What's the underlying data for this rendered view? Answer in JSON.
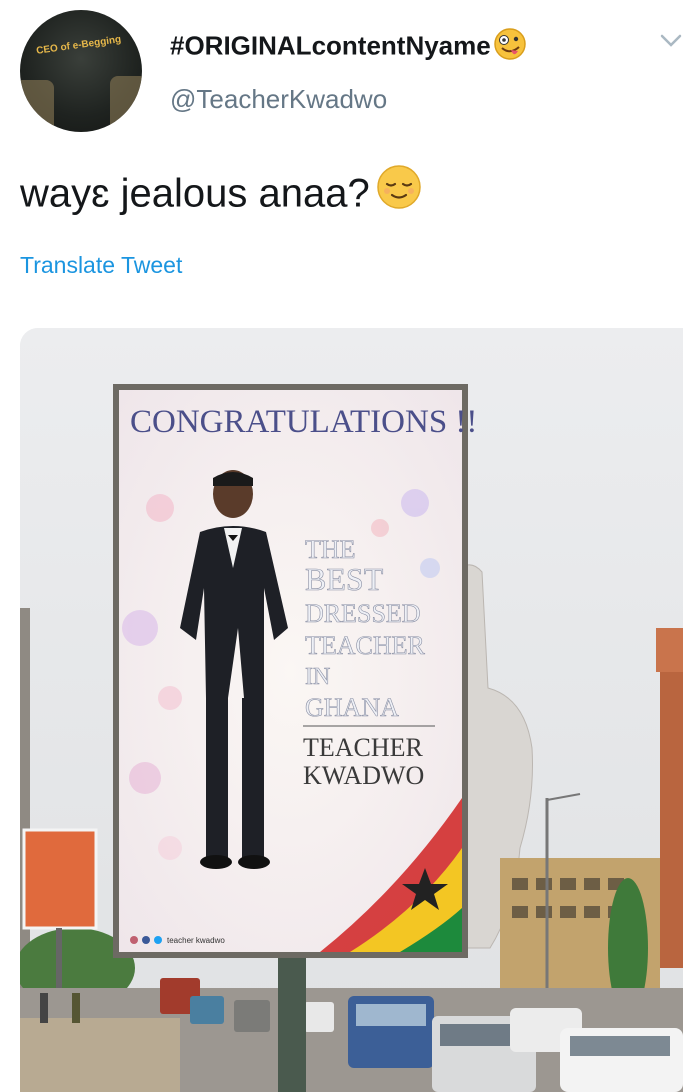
{
  "author": {
    "display_name": "#ORIGINALcontentNyame",
    "handle": "@TeacherKwadwo",
    "avatar_shirt_text": "CEO of e-Begging"
  },
  "tweet": {
    "text": "wayɛ jealous anaa?",
    "translate_label": "Translate Tweet"
  },
  "billboard": {
    "heading": "CONGRATULATIONS !!",
    "line1": "THE",
    "line2": "BEST",
    "line3": "DRESSED",
    "line4": "TEACHER",
    "line5": "IN",
    "line6": "GHANA",
    "name1": "TEACHER",
    "name2": "KWADWO",
    "social_handle": "teacher kwadwo"
  },
  "icons": {
    "caret": "chevron-down-icon",
    "emoji_name": "zany-face-emoji",
    "emoji_tweet": "relieved-face-emoji"
  },
  "colors": {
    "link": "#1b95e0",
    "text": "#14171a",
    "secondary": "#657786"
  }
}
